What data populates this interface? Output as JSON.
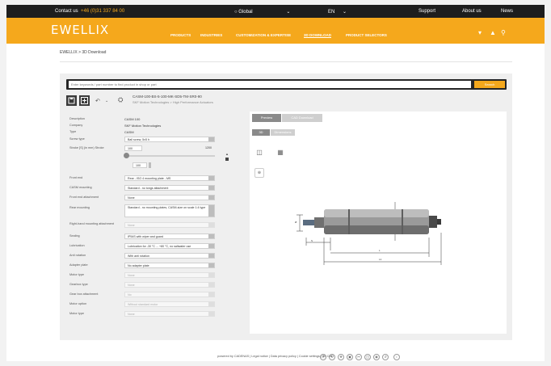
{
  "topbar": {
    "contact": "Contact us",
    "phone": "+46 (0)31 337 84 00",
    "region": "Global",
    "language": "EN",
    "support": "Support",
    "about": "About us",
    "news": "News"
  },
  "nav": {
    "logo": "EWELLIX",
    "logo_sub": "",
    "items": [
      "PRODUCTS",
      "INDUSTRIES",
      "CUSTOMIZATION & EXPERTISE",
      "3D DOWNLOAD",
      "PRODUCT SELECTORS"
    ]
  },
  "breadcrumb": "EWELLIX > 3D Download",
  "search": {
    "placeholder": "Enter keywords / part number to find product in shop or part",
    "button": "Search"
  },
  "product": {
    "title": "CASM-100-BS-5-100-MK-SD5-TM-SR0-90",
    "subtitle": "SKF Motion Technologies > High Performance Actuators"
  },
  "form": {
    "rows": [
      {
        "label": "Description",
        "value": "CASM 100",
        "type": "text"
      },
      {
        "label": "Company",
        "value": "SKF Motion Technologies",
        "type": "text"
      },
      {
        "label": "Type",
        "value": "CASM",
        "type": "text"
      },
      {
        "label": "Screw type",
        "value": "Ball screw, 5x5 h",
        "type": "select"
      },
      {
        "label": "Stroke [S] (in mm) Stroke",
        "value": "100",
        "type": "slider",
        "max": "1200"
      },
      {
        "label": "Front end",
        "value": "Rear - ISO 4 mounting plate - MS",
        "type": "select"
      },
      {
        "label": "CASM mounting",
        "value": "Standard - no tongs attachment",
        "type": "select"
      },
      {
        "label": "Front end attachment",
        "value": "None",
        "type": "select"
      },
      {
        "label": "Rear mounting",
        "value": "Standard - no mounting plates, CASM-size on scale 1:4 type",
        "type": "select-tall"
      },
      {
        "label": "Right-hand mounting attachment",
        "value": "None",
        "type": "disabled"
      },
      {
        "label": "Sealing",
        "value": "IP54S with wiper and guard",
        "type": "select"
      },
      {
        "label": "Lubrication",
        "value": "Lubrication for -30 °C ... +80 °C, no saltwater use",
        "type": "select"
      },
      {
        "label": "Anti rotation",
        "value": "With anti rotation",
        "type": "select"
      },
      {
        "label": "Adapter plate",
        "value": "No adapter plate",
        "type": "select"
      },
      {
        "label": "Motor type",
        "value": "None",
        "type": "disabled"
      },
      {
        "label": "Gearbox type",
        "value": "None",
        "type": "disabled"
      },
      {
        "label": "Gear box attachment",
        "value": "No",
        "type": "disabled"
      },
      {
        "label": "Motor option",
        "value": "Without standard motor",
        "type": "disabled"
      },
      {
        "label": "Motor type",
        "value": "None",
        "type": "disabled"
      }
    ],
    "stepper_value": "100"
  },
  "viewer": {
    "tab_preview": "Preview",
    "tab_settings": "CAD Download",
    "btn_3d": "3D",
    "btn_2d": "Dimensions",
    "view_icons": [
      "iso-view-icon",
      "front-view-icon"
    ],
    "bottom_tools": [
      "zoom-icon",
      "rotate-icon",
      "pan-icon",
      "fit-icon",
      "measure-icon",
      "section-icon",
      "screenshot-icon",
      "reset-icon",
      "info-icon"
    ]
  },
  "footer": "powered by CADENAS | Legal notice | Data privacy policy | Cookie settings | 3D CAD"
}
